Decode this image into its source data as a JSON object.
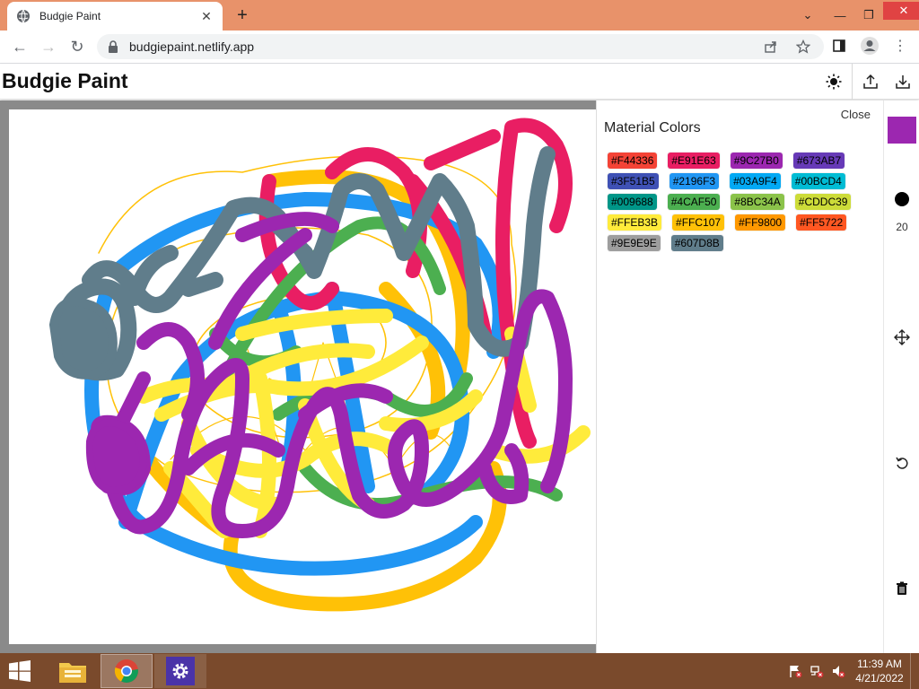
{
  "browser": {
    "tab_title": "Budgie Paint",
    "url": "budgiepaint.netlify.app",
    "tabstrip_color": "#e8926a"
  },
  "app": {
    "title": "Budgie Paint",
    "header_icons": [
      "theme-toggle-icon",
      "upload-icon",
      "download-icon"
    ]
  },
  "panel": {
    "close_label": "Close",
    "title": "Material Colors",
    "colors": [
      "#F44336",
      "#E91E63",
      "#9C27B0",
      "#673AB7",
      "#3F51B5",
      "#2196F3",
      "#03A9F4",
      "#00BCD4",
      "#009688",
      "#4CAF50",
      "#8BC34A",
      "#CDDC39",
      "#FFEB3B",
      "#FFC107",
      "#FF9800",
      "#FF5722",
      "#9E9E9E",
      "#607D8B"
    ]
  },
  "rail": {
    "current_color": "#9C27B0",
    "brush_size": "20",
    "icons": [
      "brush-size-dot-icon",
      "move-icon",
      "undo-icon",
      "trash-icon"
    ]
  },
  "canvas": {
    "stroke_colors": [
      "#FFC107",
      "#2196F3",
      "#E91E63",
      "#4CAF50",
      "#FFEB3B",
      "#607D8B",
      "#9C27B0"
    ]
  },
  "taskbar": {
    "time": "11:39 AM",
    "date": "4/21/2022",
    "color": "#7a4a2c"
  }
}
